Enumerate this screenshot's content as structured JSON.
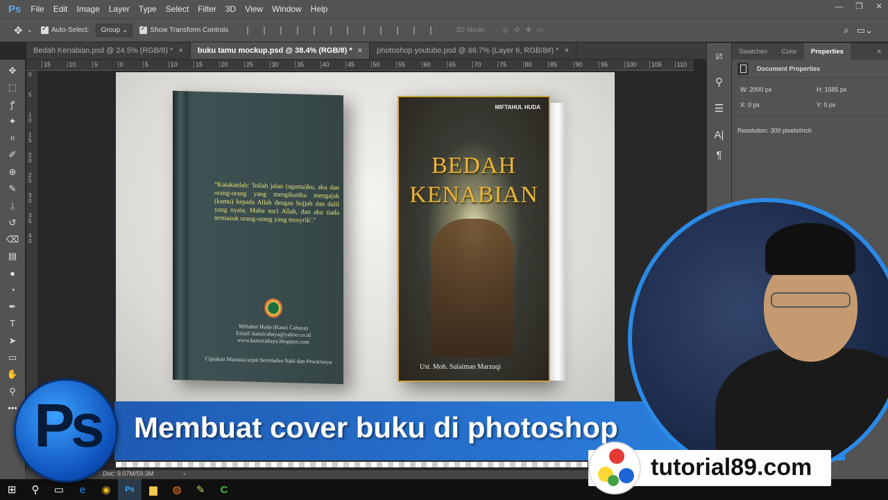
{
  "app": {
    "logo": "Ps"
  },
  "menu": [
    "File",
    "Edit",
    "Image",
    "Layer",
    "Type",
    "Select",
    "Filter",
    "3D",
    "View",
    "Window",
    "Help"
  ],
  "window_controls": [
    "—",
    "❐",
    "✕"
  ],
  "options": {
    "auto_select_label": "Auto-Select:",
    "auto_select_checked": true,
    "auto_select_value": "Group",
    "show_transform_label": "Show Transform Controls",
    "show_transform_checked": true,
    "mode_label": "3D Mode:"
  },
  "tabs": [
    {
      "label": "Bedah Kenabian.psd @ 24.5% (RGB/8) *",
      "active": false
    },
    {
      "label": "buku tamu mockup.psd @ 38.4% (RGB/8) *",
      "active": true
    },
    {
      "label": "photoshop youtube.psd @ 66.7% (Layer 6, RGB/8#) *",
      "active": false
    }
  ],
  "ruler_ticks": [
    "15",
    "10",
    "5",
    "0",
    "5",
    "10",
    "15",
    "20",
    "25",
    "30",
    "35",
    "40",
    "45",
    "50",
    "55",
    "60",
    "65",
    "70",
    "75",
    "80",
    "85",
    "90",
    "95",
    "100",
    "105",
    "110"
  ],
  "vruler_ticks": [
    "0",
    "5",
    "1\n0",
    "1\n5",
    "2\n0",
    "2\n5",
    "3\n0",
    "3\n5",
    "4\n0"
  ],
  "properties": {
    "tabs": [
      "Swatches",
      "Color",
      "Properties"
    ],
    "section": "Document Properties",
    "w_label": "W:",
    "w": "2000 px",
    "h_label": "H:",
    "h": "1585 px",
    "x_label": "X:",
    "x": "0 px",
    "y_label": "Y:",
    "y": "0 px",
    "resolution": "Resolution: 300 pixels/inch"
  },
  "status": {
    "doc": "Doc: 9.07M/59.3M",
    "arrow": "›"
  },
  "canvas": {
    "back_cover": {
      "quote": "“Katakanlah: 'Inilah jalan (agama)ku, aku dan orang-orang yang mengikutiku mengajak (kamu) kepada Allah dengan hujjah dan dalil yang nyata, Maha suci Allah, dan aku tiada termasuk orang-orang yang musyrik'.”",
      "credits": [
        "Miftahul Huda (Kanzi Cahaya)",
        "Email: kanzicahaya@yahoo.co.id",
        "www.kanzicahaya.blogspot.com"
      ],
      "tagline": "Ciptakan Manusia sejati berteladan Nabi dan Pewarisnya"
    },
    "front_cover": {
      "author_top": "MIFTAHUL HUDA",
      "title_line1": "BEDAH",
      "title_line2": "KENABIAN",
      "author_bottom": "Ust. Moh. Sulaiman Marzuqi"
    }
  },
  "overlay": {
    "banner": "Membuat cover buku di photoshop",
    "site": "tutorial89.com",
    "ps_logo": "Ps",
    "banner_color": "#2a7ad8"
  }
}
